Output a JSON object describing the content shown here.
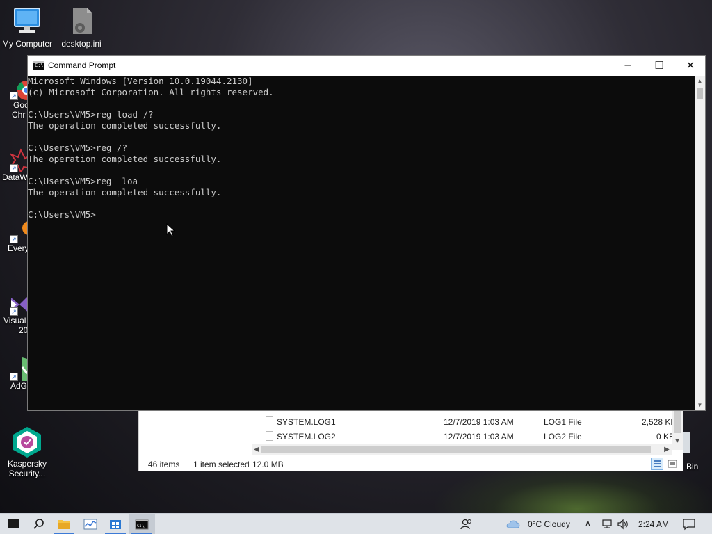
{
  "desktop": {
    "icons": [
      {
        "label": "My Computer"
      },
      {
        "label": "desktop.ini"
      }
    ],
    "side_icons": [
      {
        "label": "Goo",
        "label2": "Chr"
      },
      {
        "label": "DataW"
      },
      {
        "label": "Every"
      },
      {
        "label": "Visual",
        "label2": "20"
      },
      {
        "label": "AdG"
      }
    ],
    "kaspersky": {
      "line1": "Kaspersky",
      "line2": "Security..."
    },
    "recycle_bin_partial": "Bin"
  },
  "explorer": {
    "rows": [
      {
        "name": "SYSTEM.LOG1",
        "date": "12/7/2019 1:03 AM",
        "type": "LOG1 File",
        "size": "2,528 KB"
      },
      {
        "name": "SYSTEM.LOG2",
        "date": "12/7/2019 1:03 AM",
        "type": "LOG2 File",
        "size": "0 KB"
      }
    ],
    "status": {
      "items": "46 items",
      "selected": "1 item selected",
      "size": "12.0 MB"
    }
  },
  "cmd": {
    "title": "Command Prompt",
    "icon_text": "C:\\",
    "buttons": {
      "minimize": "─",
      "maximize": "☐",
      "close": "✕"
    },
    "lines": [
      "Microsoft Windows [Version 10.0.19044.2130]",
      "(c) Microsoft Corporation. All rights reserved.",
      "",
      "C:\\Users\\VM5>reg load /?",
      "The operation completed successfully.",
      "",
      "C:\\Users\\VM5>reg /?",
      "The operation completed successfully.",
      "",
      "C:\\Users\\VM5>reg  loa",
      "The operation completed successfully.",
      "",
      "C:\\Users\\VM5>"
    ]
  },
  "taskbar": {
    "weather": "0°C  Cloudy",
    "time": "2:24 AM",
    "accent": "#3d7ad6"
  }
}
